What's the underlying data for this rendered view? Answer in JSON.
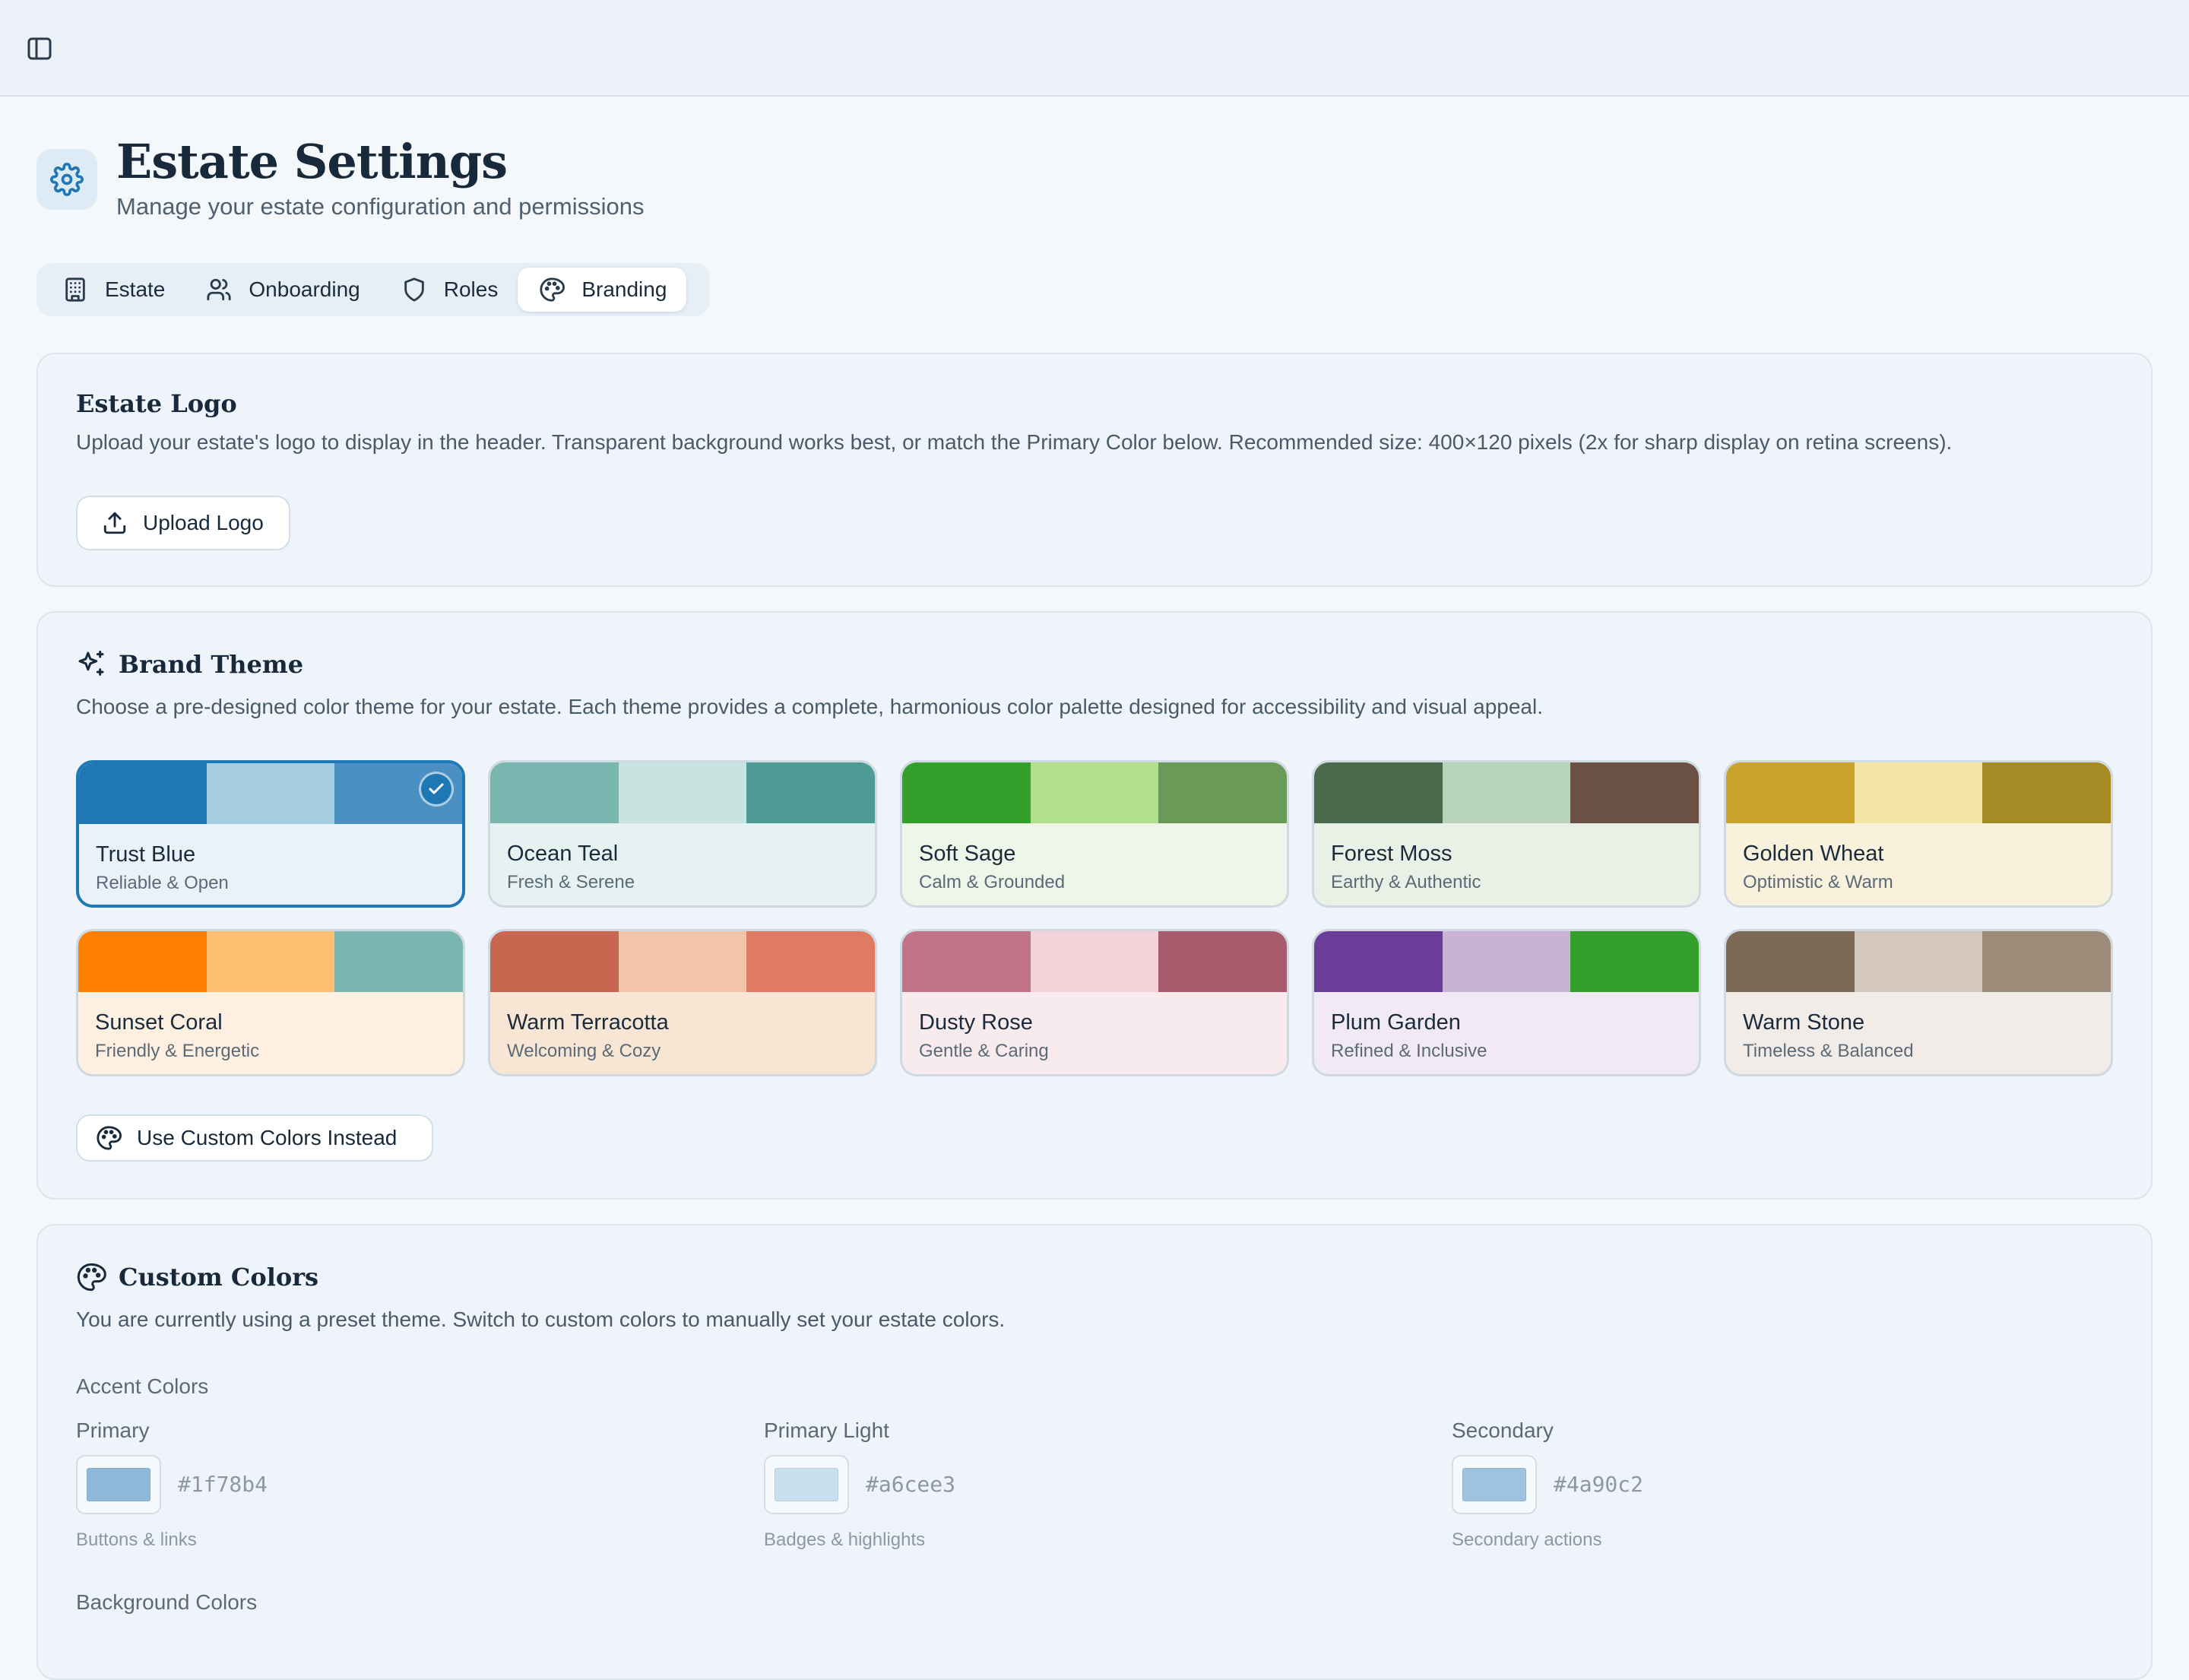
{
  "header": {
    "title": "Estate Settings",
    "subtitle": "Manage your estate configuration and permissions"
  },
  "tabs": [
    {
      "label": "Estate",
      "icon": "building-icon"
    },
    {
      "label": "Onboarding",
      "icon": "users-icon"
    },
    {
      "label": "Roles",
      "icon": "shield-icon"
    },
    {
      "label": "Branding",
      "icon": "palette-icon",
      "active": true
    }
  ],
  "logo": {
    "title": "Estate Logo",
    "description": "Upload your estate's logo to display in the header. Transparent background works best, or match the Primary Color below. Recommended size: 400×120 pixels (2x for sharp display on retina screens).",
    "upload_label": "Upload Logo"
  },
  "theme": {
    "title": "Brand Theme",
    "description": "Choose a pre-designed color theme for your estate. Each theme provides a complete, harmonious color palette designed for accessibility and visual appeal.",
    "custom_button": "Use Custom Colors Instead",
    "themes": [
      {
        "name": "Trust Blue",
        "tagline": "Reliable & Open",
        "colors": [
          "#1f78b4",
          "#a6cee3",
          "#4a90c2"
        ],
        "bg": "#eaf2f9",
        "selected": true
      },
      {
        "name": "Ocean Teal",
        "tagline": "Fresh & Serene",
        "colors": [
          "#79b6b0",
          "#c8e4e1",
          "#4e9a95"
        ],
        "bg": "#e6f2f1"
      },
      {
        "name": "Soft Sage",
        "tagline": "Calm & Grounded",
        "colors": [
          "#33a02c",
          "#b2df8a",
          "#6a9a58"
        ],
        "bg": "#eef6e9"
      },
      {
        "name": "Forest Moss",
        "tagline": "Earthy & Authentic",
        "colors": [
          "#4a6b4b",
          "#b8d4b8",
          "#6b5144"
        ],
        "bg": "#e9f0e6"
      },
      {
        "name": "Golden Wheat",
        "tagline": "Optimistic & Warm",
        "colors": [
          "#cba22c",
          "#f4e4a6",
          "#a68a24"
        ],
        "bg": "#f8f1dc"
      },
      {
        "name": "Sunset Coral",
        "tagline": "Friendly & Energetic",
        "colors": [
          "#ff7f00",
          "#fdbf6f",
          "#79b6b0"
        ],
        "bg": "#fdf0e0"
      },
      {
        "name": "Warm Terracotta",
        "tagline": "Welcoming & Cozy",
        "colors": [
          "#c9664f",
          "#f3c4a8",
          "#e07b63"
        ],
        "bg": "#f6e6d3"
      },
      {
        "name": "Dusty Rose",
        "tagline": "Gentle & Caring",
        "colors": [
          "#c37387",
          "#f3d3da",
          "#a75b6d"
        ],
        "bg": "#f8ebed"
      },
      {
        "name": "Plum Garden",
        "tagline": "Refined & Inclusive",
        "colors": [
          "#6a3d9a",
          "#cab2d6",
          "#33a02c"
        ],
        "bg": "#f1eaf5"
      },
      {
        "name": "Warm Stone",
        "tagline": "Timeless & Balanced",
        "colors": [
          "#7c6a56",
          "#d4c8bc",
          "#9c8b78"
        ],
        "bg": "#f1ece7"
      }
    ]
  },
  "custom": {
    "title": "Custom Colors",
    "description": "You are currently using a preset theme. Switch to custom colors to manually set your estate colors.",
    "accent_label": "Accent Colors",
    "accent": [
      {
        "label": "Primary",
        "hex": "#1f78b4",
        "hint": "Buttons & links",
        "preview": "#8fb8da"
      },
      {
        "label": "Primary Light",
        "hex": "#a6cee3",
        "hint": "Badges & highlights",
        "preview": "#c9e1ee"
      },
      {
        "label": "Secondary",
        "hex": "#4a90c2",
        "hint": "Secondary actions",
        "preview": "#9fc2e0"
      }
    ],
    "background_label": "Background Colors"
  }
}
